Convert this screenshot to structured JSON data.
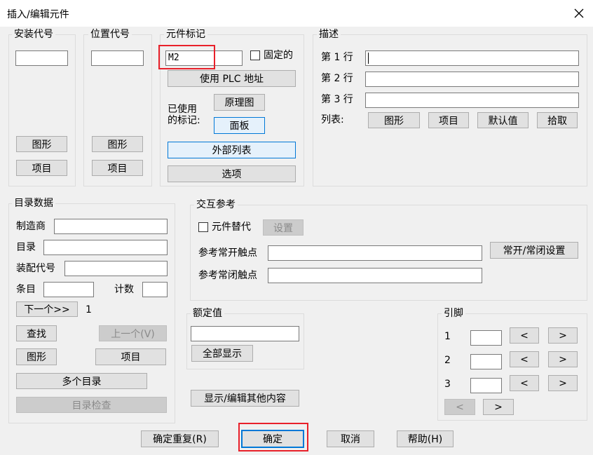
{
  "window": {
    "title": "插入/编辑元件"
  },
  "install_code": {
    "legend": "安装代号",
    "value": "",
    "graphic_btn": "图形",
    "item_btn": "项目"
  },
  "location_code": {
    "legend": "位置代号",
    "value": "",
    "graphic_btn": "图形",
    "item_btn": "项目"
  },
  "component_tag": {
    "legend": "元件标记",
    "value": "M2",
    "fixed_label": "固定的",
    "plc_btn": "使用 PLC 地址",
    "used_tags_label": "已使用\n的标记:",
    "schematic_btn": "原理图",
    "panel_btn": "面板",
    "external_list_btn": "外部列表",
    "options_btn": "选项"
  },
  "description": {
    "legend": "描述",
    "lines": [
      {
        "label": "第 1 行",
        "value": ""
      },
      {
        "label": "第 2 行",
        "value": ""
      },
      {
        "label": "第 3 行",
        "value": ""
      }
    ],
    "list_label": "列表:",
    "graphic_btn": "图形",
    "item_btn": "项目",
    "default_btn": "默认值",
    "pick_btn": "拾取"
  },
  "catalog": {
    "legend": "目录数据",
    "manufacturer_label": "制造商",
    "catalog_label": "目录",
    "assembly_label": "装配代号",
    "entry_label": "条目",
    "count_label": "计数",
    "next_btn": "下一个>>",
    "count_value": "1",
    "find_btn": "查找",
    "prev_btn": "上一个(V)",
    "graphic_btn": "图形",
    "item_btn": "项目",
    "multi_btn": "多个目录",
    "check_btn": "目录检查"
  },
  "xref": {
    "legend": "交互参考",
    "substitute_label": "元件替代",
    "setup_btn": "设置",
    "no_contact_label": "参考常开触点",
    "nc_contact_label": "参考常闭触点",
    "no_nc_setup_btn": "常开/常闭设置"
  },
  "rating": {
    "legend": "额定值",
    "value": "",
    "show_all_btn": "全部显示"
  },
  "show_edit_btn": "显示/编辑其他内容",
  "pins": {
    "legend": "引脚",
    "rows": [
      "1",
      "2",
      "3"
    ],
    "prev_glyph": "<",
    "next_glyph": ">"
  },
  "footer": {
    "ok_repeat_btn": "确定重复(R)",
    "ok_btn": "确定",
    "cancel_btn": "取消",
    "help_btn": "帮助(H)"
  }
}
